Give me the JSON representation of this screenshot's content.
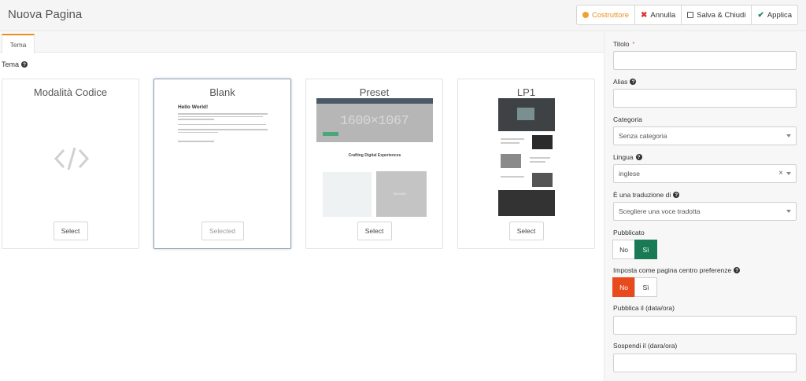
{
  "header": {
    "title": "Nuova Pagina",
    "toolbar": {
      "builder": "Costruttore",
      "cancel": "Annulla",
      "save_close": "Salva & Chiudi",
      "apply": "Applica"
    }
  },
  "tabs": {
    "theme": "Tema"
  },
  "section": {
    "label": "Tema"
  },
  "templates": [
    {
      "title": "Modalità Codice",
      "button": "Select"
    },
    {
      "title": "Blank",
      "button": "Selected",
      "preview_heading": "Hello World!"
    },
    {
      "title": "Preset",
      "button": "Select",
      "preview_hero": "1600×1067",
      "preview_heading": "Crafting Digital Experiences",
      "preview_img": "580×500"
    },
    {
      "title": "LP1",
      "button": "Select"
    }
  ],
  "form": {
    "titolo": {
      "label": "Titolo",
      "required": "*",
      "value": ""
    },
    "alias": {
      "label": "Alias",
      "value": ""
    },
    "categoria": {
      "label": "Categoria",
      "value": "Senza categoria"
    },
    "lingua": {
      "label": "Lingua",
      "value": "inglese",
      "clear": "×"
    },
    "traduzione": {
      "label": "È una traduzione di",
      "placeholder": "Scegliere una voce tradotta"
    },
    "pubblicato": {
      "label": "Pubblicato",
      "no": "No",
      "si": "Sì",
      "selected": "Sì"
    },
    "preferenze": {
      "label": "Imposta come pagina centro preferenze",
      "no": "No",
      "si": "Sì",
      "selected": "No"
    },
    "pubblica_il": {
      "label": "Pubblica il (data/ora)",
      "value": ""
    },
    "sospendi_il": {
      "label": "Sospendi il (dara/ora)",
      "value": ""
    }
  },
  "colors": {
    "accent_orange": "#e8901e",
    "green": "#1a7a56",
    "red": "#e84a1e"
  }
}
